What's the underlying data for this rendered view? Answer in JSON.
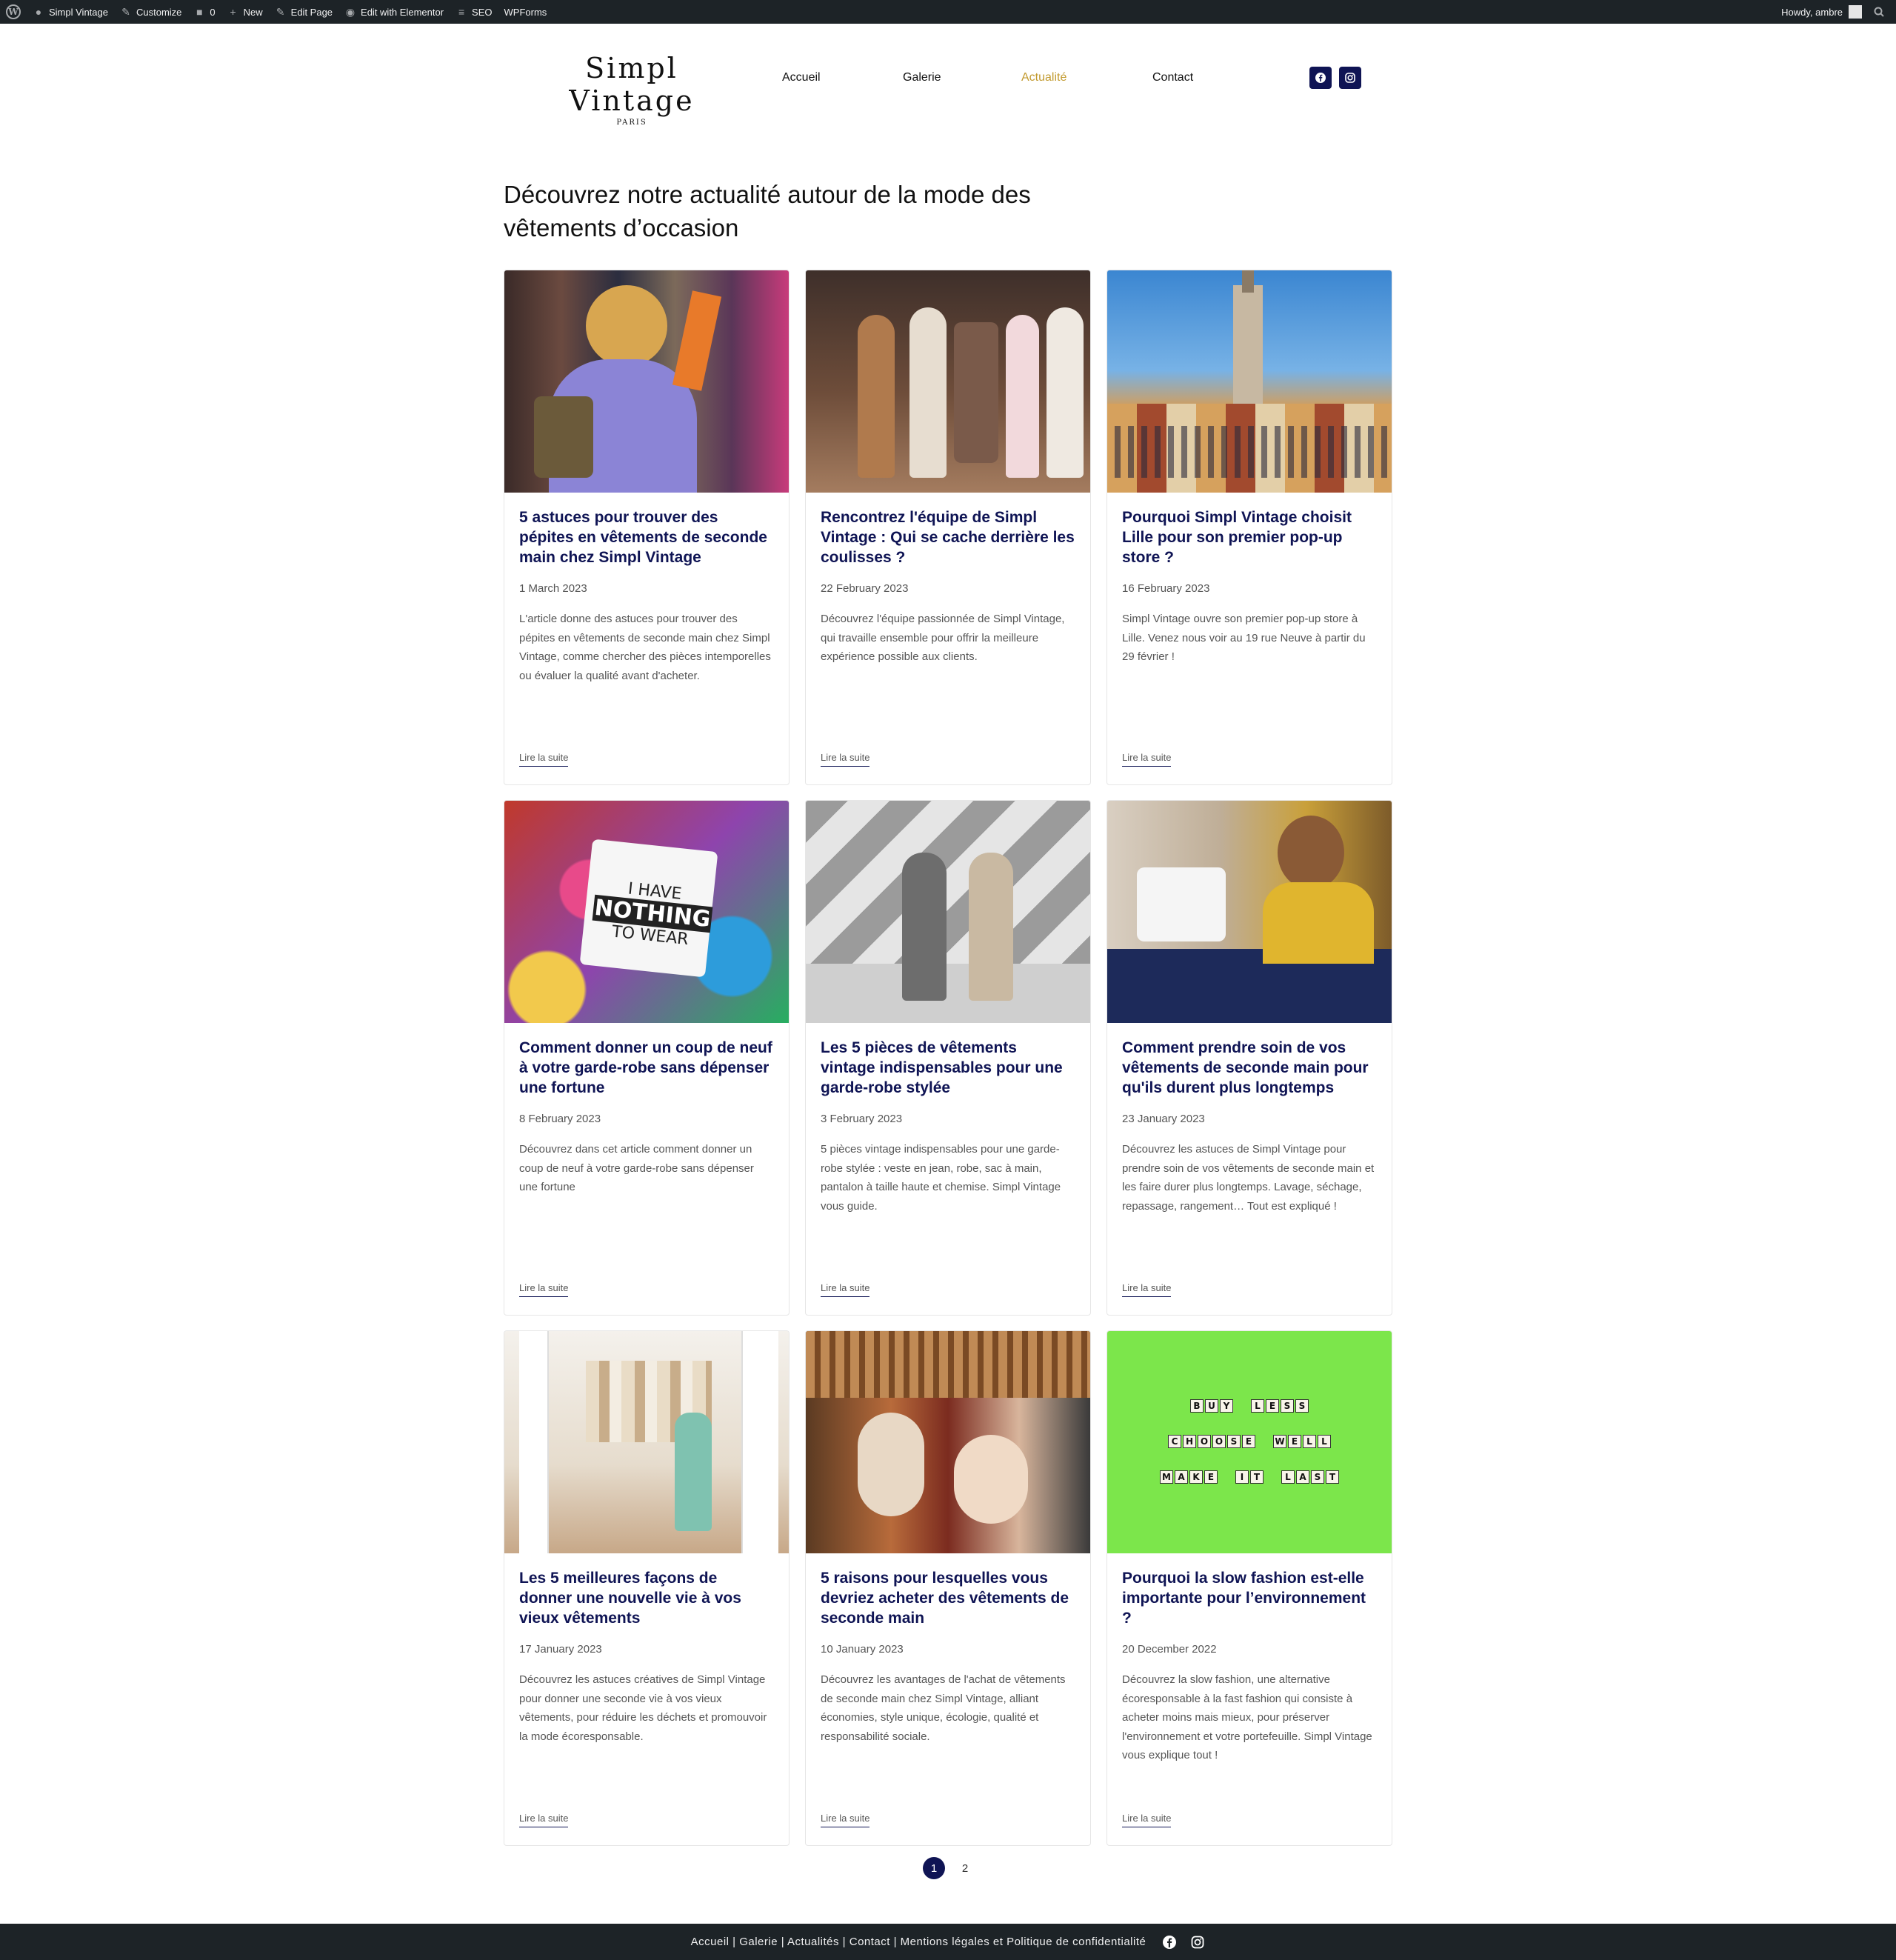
{
  "adminbar": {
    "site_name": "Simpl Vintage",
    "customize": "Customize",
    "comments_count": "0",
    "new": "New",
    "edit_page": "Edit Page",
    "edit_elementor": "Edit with Elementor",
    "seo": "SEO",
    "wpforms": "WPForms",
    "howdy": "Howdy, ambre"
  },
  "header": {
    "logo_title": "Simpl Vintage",
    "logo_sub": "PARIS",
    "nav": [
      "Accueil",
      "Galerie",
      "Actualité",
      "Contact"
    ],
    "active_nav": "Actualité",
    "social_icons": [
      "facebook-icon",
      "instagram-icon"
    ]
  },
  "page": {
    "title": "Découvrez notre actualité autour de la mode des vêtements d’occasion"
  },
  "posts": [
    {
      "title": "5 astuces pour trouver des pépites en vêtements de seconde main chez Simpl Vintage",
      "date": "1 March 2023",
      "excerpt": "L'article donne des astuces pour trouver des pépites en vêtements de seconde main chez Simpl Vintage, comme chercher des pièces intemporelles ou évaluer la qualité avant d'acheter.",
      "more": "Lire la suite"
    },
    {
      "title": "Rencontrez l'équipe de Simpl Vintage : Qui se cache derrière les coulisses ?",
      "date": "22 February 2023",
      "excerpt": "Découvrez l'équipe passionnée de Simpl Vintage, qui travaille ensemble pour offrir la meilleure expérience possible aux clients.",
      "more": "Lire la suite"
    },
    {
      "title": "Pourquoi Simpl Vintage choisit Lille pour son premier pop-up store ?",
      "date": "16 February 2023",
      "excerpt": "Simpl Vintage ouvre son premier pop-up store à Lille. Venez nous voir au 19 rue Neuve à partir du 29 février !",
      "more": "Lire la suite"
    },
    {
      "title": "Comment donner un coup de neuf à votre garde-robe sans dépenser une fortune",
      "date": "8 February 2023",
      "excerpt": "Découvrez dans cet article comment donner un coup de neuf à votre garde-robe sans dépenser une fortune",
      "more": "Lire la suite",
      "image_text": [
        "I HAVE",
        "NOTHING",
        "TO WEAR"
      ]
    },
    {
      "title": "Les 5 pièces de vêtements vintage indispensables pour une garde-robe stylée",
      "date": "3 February 2023",
      "excerpt": "5 pièces vintage indispensables pour une garde-robe stylée : veste en jean, robe, sac à main, pantalon à taille haute et chemise. Simpl Vintage vous guide.",
      "more": "Lire la suite"
    },
    {
      "title": "Comment prendre soin de vos vêtements de seconde main pour qu'ils durent plus longtemps",
      "date": "23 January 2023",
      "excerpt": "Découvrez les astuces de Simpl Vintage pour prendre soin de vos vêtements de seconde main et les faire durer plus longtemps. Lavage, séchage, repassage, rangement… Tout est expliqué !",
      "more": "Lire la suite"
    },
    {
      "title": "Les 5 meilleures façons de donner une nouvelle vie à vos vieux vêtements",
      "date": "17 January 2023",
      "excerpt": "Découvrez les astuces créatives de Simpl Vintage pour donner une seconde vie à vos vieux vêtements, pour réduire les déchets et promouvoir la mode écoresponsable.",
      "more": "Lire la suite"
    },
    {
      "title": "5 raisons pour lesquelles vous devriez acheter des vêtements de seconde main",
      "date": "10 January 2023",
      "excerpt": "Découvrez les avantages de l'achat de vêtements de seconde main chez Simpl Vintage, alliant économies, style unique, écologie, qualité et responsabilité sociale.",
      "more": "Lire la suite"
    },
    {
      "title": "Pourquoi la slow fashion est-elle importante pour l’environnement ?",
      "date": "20 December 2022",
      "excerpt": "Découvrez la slow fashion, une alternative écoresponsable à la fast fashion qui consiste à acheter moins mais mieux, pour préserver l'environnement et votre portefeuille. Simpl Vintage vous explique tout !",
      "more": "Lire la suite",
      "image_text": [
        [
          "BUY",
          "LESS"
        ],
        [
          "CHOOSE",
          "WELL"
        ],
        [
          "MAKE",
          "IT",
          "LAST"
        ]
      ]
    }
  ],
  "pagination": {
    "pages": [
      "1",
      "2"
    ],
    "current": "1"
  },
  "footer": {
    "links": "Accueil | Galerie | Actualités | Contact | Mentions légales et Politique de confidentialité",
    "icons": [
      "facebook-icon",
      "instagram-icon"
    ]
  },
  "colors": {
    "navy": "#0f1454",
    "gold": "#c29a2f",
    "bar": "#1d2327"
  }
}
